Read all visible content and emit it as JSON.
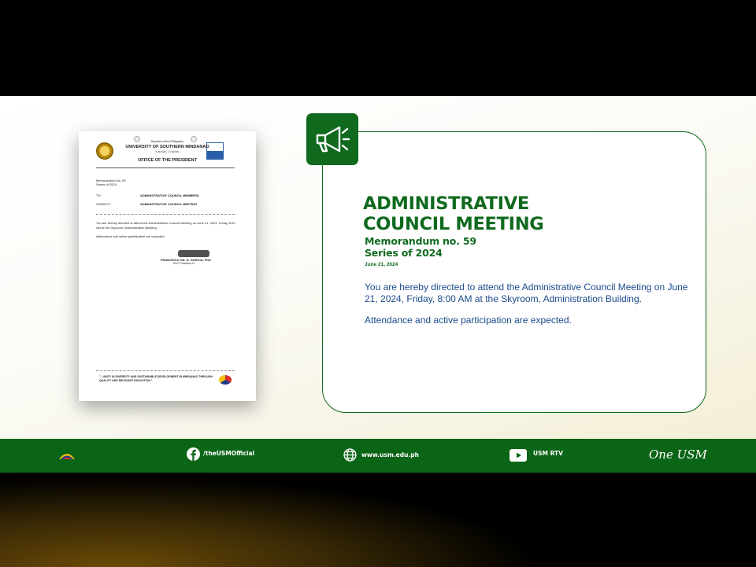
{
  "document": {
    "republic": "Republic of the Philippines",
    "university": "UNIVERSITY OF SOUTHERN MINDANAO",
    "location": "Kabacan, Cotabato",
    "office": "OFFICE OF THE PRESIDENT",
    "memo_no": "Memorandum No. 59",
    "series": "Series of 2024",
    "to_label": "TO:",
    "to_value": "ADMINISTRATIVE COUNCIL MEMBERS",
    "subject_label": "SUBJECT:",
    "subject_value": "ADMINISTRATIVE COUNCIL MEETING",
    "body_1": "You are hereby directed to attend the Administrative Council Meeting on June 21, 2024, Friday, 8:00 AM at the Skyroom, Administration Building.",
    "body_2": "Attendance and active participation are expected.",
    "signatory": "FRANCISCO GIL N. GARCIA, PhD",
    "signatory_title": "SUC President IV",
    "motto": "\"...UNITY IN DIVERSITY AND SUSTAINABLE DEVELOPMENT IN MINDANAO THROUGH QUALITY AND RELEVANT EDUCATION.\""
  },
  "card": {
    "title_line1": "ADMINISTRATIVE",
    "title_line2": "COUNCIL MEETING",
    "memo_no": "Memorandum no. 59",
    "series": "Series of 2024",
    "date": "June 21, 2024",
    "paragraph_1": "You are hereby directed to attend the Administrative Council Meeting on June 21, 2024, Friday, 8:00 AM at the Skyroom, Administration Building.",
    "paragraph_2": "Attendance and active participation are expected."
  },
  "footer": {
    "facebook": "/theUSMOfficial",
    "website": "www.usm.edu.ph",
    "youtube": "USM RTV",
    "tagline": "One USM"
  },
  "colors": {
    "brand_green": "#0f6a1e",
    "text_blue": "#1a4a8a",
    "footer_green": "#0b6516"
  }
}
